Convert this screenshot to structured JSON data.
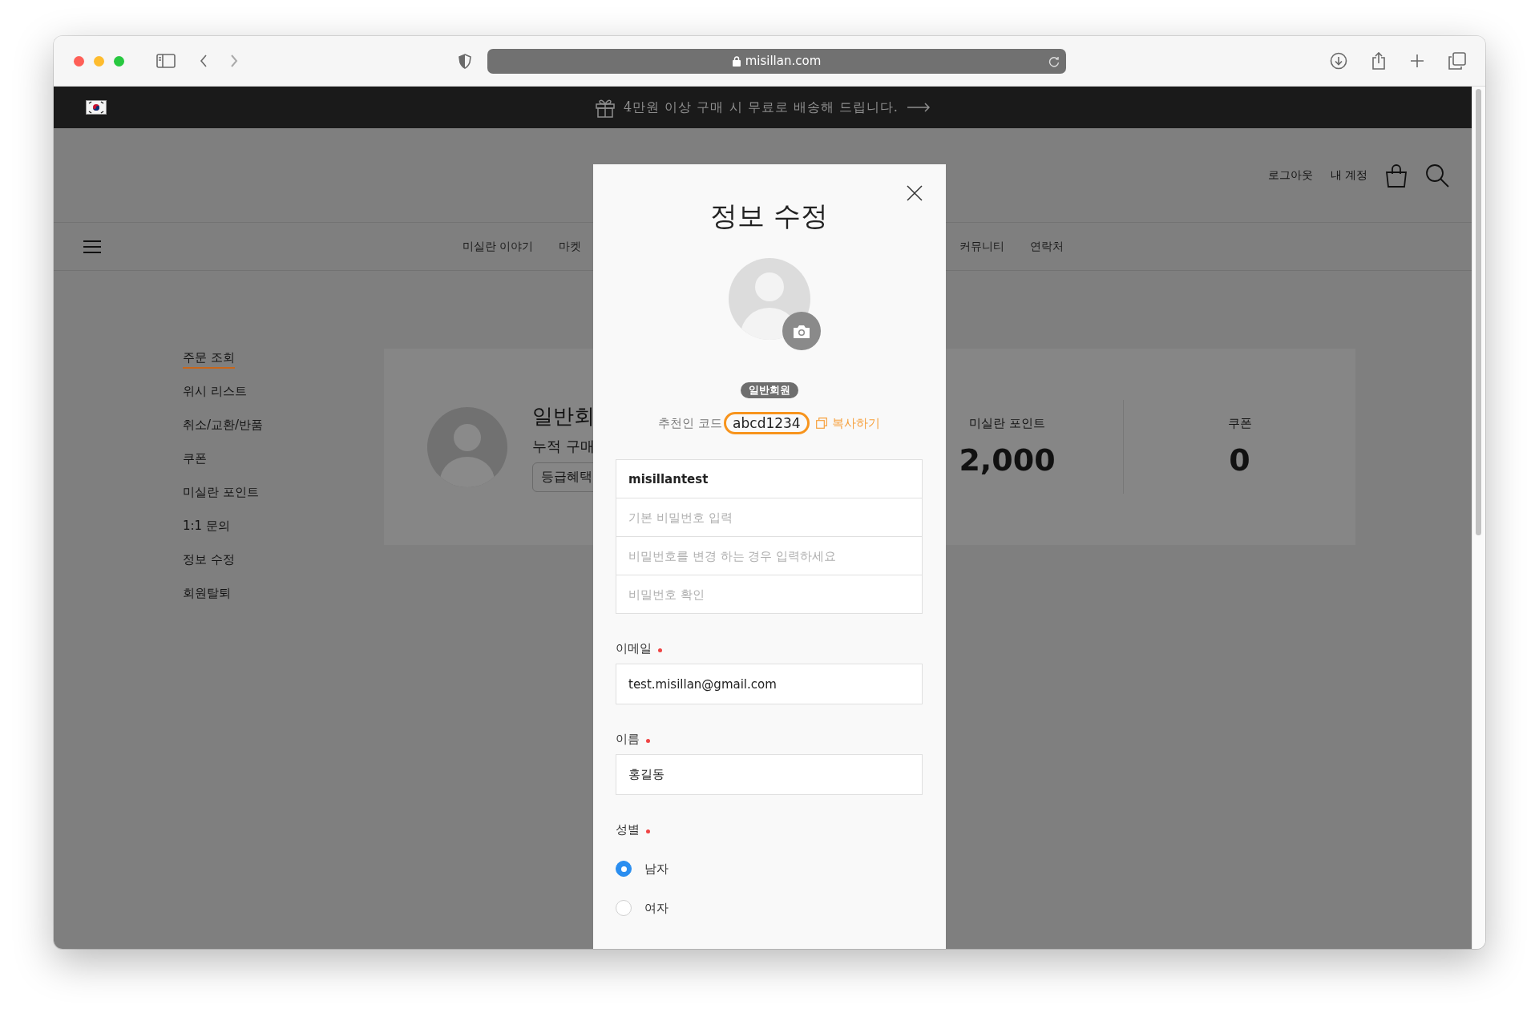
{
  "browser": {
    "url": "misillan.com"
  },
  "promo_bar": {
    "text": "4만원 이상 구매 시 무료로 배송해 드립니다."
  },
  "header": {
    "links": [
      "로그아웃",
      "내 계정"
    ]
  },
  "nav": {
    "items": [
      "미실란 이야기",
      "마켓",
      "커뮤니티",
      "연락처"
    ]
  },
  "sidebar": {
    "items": [
      {
        "label": "주문 조회",
        "selected": true
      },
      {
        "label": "위시 리스트",
        "selected": false
      },
      {
        "label": "취소/교환/반품",
        "selected": false
      },
      {
        "label": "쿠폰",
        "selected": false
      },
      {
        "label": "미실란 포인트",
        "selected": false
      },
      {
        "label": "1:1 문의",
        "selected": false
      },
      {
        "label": "정보 수정",
        "selected": false
      },
      {
        "label": "회원탈퇴",
        "selected": false
      }
    ]
  },
  "profile_card": {
    "name": "일반회",
    "subtitle": "누적 구매",
    "button": "등급혜택",
    "stats": [
      {
        "label": "미실란 포인트",
        "value": "2,000"
      },
      {
        "label": "쿠폰",
        "value": "0"
      }
    ]
  },
  "modal": {
    "title": "정보 수정",
    "badge": "일반회원",
    "referral": {
      "label": "추천인 코드",
      "code": "abcd1234",
      "copy": "복사하기"
    },
    "account_fields": [
      {
        "value": "misillantest"
      },
      {
        "placeholder": "기본 비밀번호 입력"
      },
      {
        "placeholder": "비밀번호를 변경 하는 경우 입력하세요"
      },
      {
        "placeholder": "비밀번호 확인"
      }
    ],
    "fields": [
      {
        "label": "이메일",
        "required": true,
        "value": "test.misillan@gmail.com"
      },
      {
        "label": "이름",
        "required": true,
        "value": "홍길동"
      }
    ],
    "gender": {
      "label": "성별",
      "required": true,
      "options": [
        {
          "label": "남자",
          "selected": true
        },
        {
          "label": "여자",
          "selected": false
        }
      ]
    }
  }
}
